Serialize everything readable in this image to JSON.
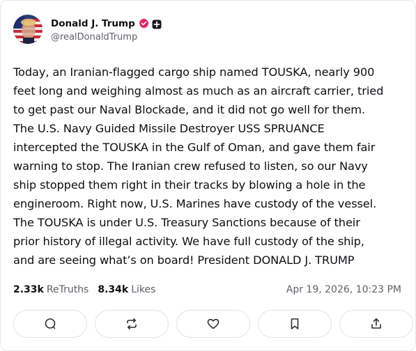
{
  "author": {
    "display_name": "Donald J. Trump",
    "handle": "@realDonaldTrump",
    "avatar_icon": "avatar-flag-portrait",
    "verified_color": "#e0245e"
  },
  "post": {
    "lines": [
      "Today, an Iranian-flagged cargo ship named TOUSKA, nearly 900",
      "feet long and weighing almost as much as an aircraft carrier, tried",
      "to get past our Naval Blockade, and it did not go well for them.",
      "The U.S. Navy Guided Missile Destroyer USS SPRUANCE",
      "intercepted the TOUSKA in the Gulf of Oman, and gave them fair",
      "warning to stop. The Iranian crew refused to listen, so our Navy",
      "ship stopped them right in their tracks by blowing a hole in the",
      "engineroom. Right now, U.S. Marines have custody of the vessel.",
      "The TOUSKA is under U.S. Treasury Sanctions because of their",
      "prior history of illegal activity. We have full custody of the ship,",
      "and are seeing what’s on board! President DONALD J. TRUMP"
    ]
  },
  "stats": {
    "retruths_count": "2.33k",
    "retruths_label": "ReTruths",
    "likes_count": "8.34k",
    "likes_label": "Likes",
    "timestamp": "Apr 19, 2026, 10:23 PM"
  },
  "actions": [
    {
      "icon": "reply-icon"
    },
    {
      "icon": "retruth-icon"
    },
    {
      "icon": "like-icon"
    },
    {
      "icon": "bookmark-icon"
    },
    {
      "icon": "share-icon"
    }
  ]
}
